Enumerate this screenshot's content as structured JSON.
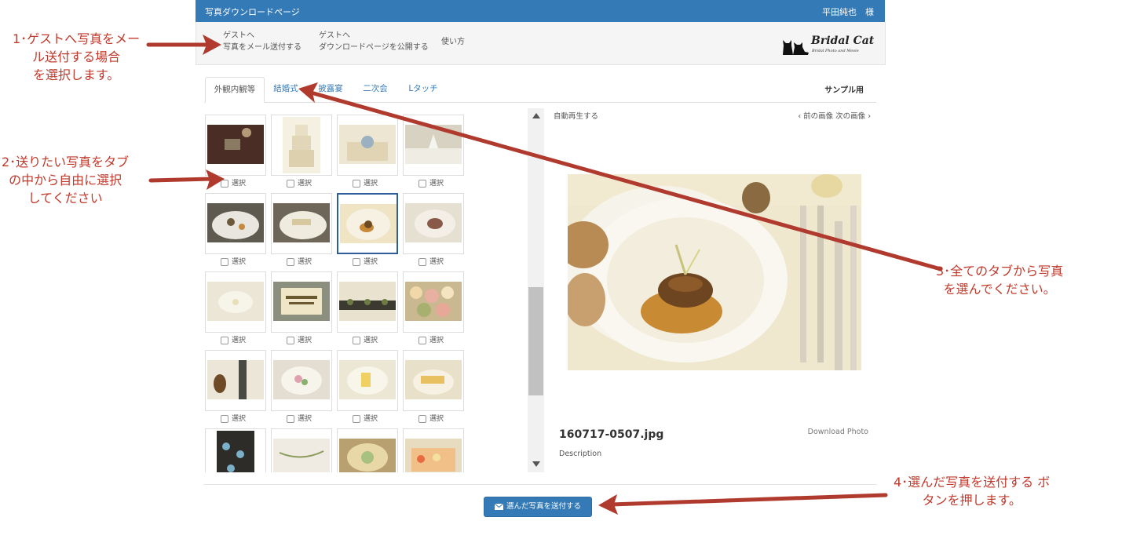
{
  "topbar": {
    "title": "写真ダウンロードページ",
    "user": "平田純也　様",
    "color": "#337ab7"
  },
  "nav": {
    "items": [
      {
        "line1": "ゲストへ",
        "line2": "写真をメール送付する"
      },
      {
        "line1": "ゲストへ",
        "line2": "ダウンロードページを公開する"
      },
      {
        "line1": "使い方",
        "line2": ""
      }
    ],
    "brand_name": "Bridal Cat",
    "brand_sub": "Bridal Photo and Movie"
  },
  "tabs": {
    "items": [
      "外観内観等",
      "結婚式",
      "披露宴",
      "二次会",
      "Lタッチ"
    ],
    "active": "外観内観等",
    "sample_label": "サンプル用"
  },
  "gallery": {
    "select_label": "選択",
    "selected_photo": "row 2, column 3",
    "icons": [
      "scroll-up-arrow-icon",
      "scroll-down-arrow-icon",
      "checkbox-icon"
    ]
  },
  "viewer": {
    "autoplay": "自動再生する",
    "prev": "‹ 前の画像",
    "next": "次の画像 ›",
    "filename": "160717-0507.jpg",
    "download": "Download Photo",
    "description": "Description"
  },
  "actions": {
    "send_label": "選んだ写真を送付する",
    "send_icon": "envelope-icon"
  },
  "annotations": {
    "note1": "1･ゲストへ写真をメー\nル送付する場合\nを選択します。",
    "note2": "2･送りたい写真をタブ\nの中から自由に選択\nしてください",
    "note3": "3･全てのタブから写真\nを選んでください。",
    "note4": "4･選んだ写真を送付する ボ\nタンを押します。",
    "color": "#c0392b"
  }
}
